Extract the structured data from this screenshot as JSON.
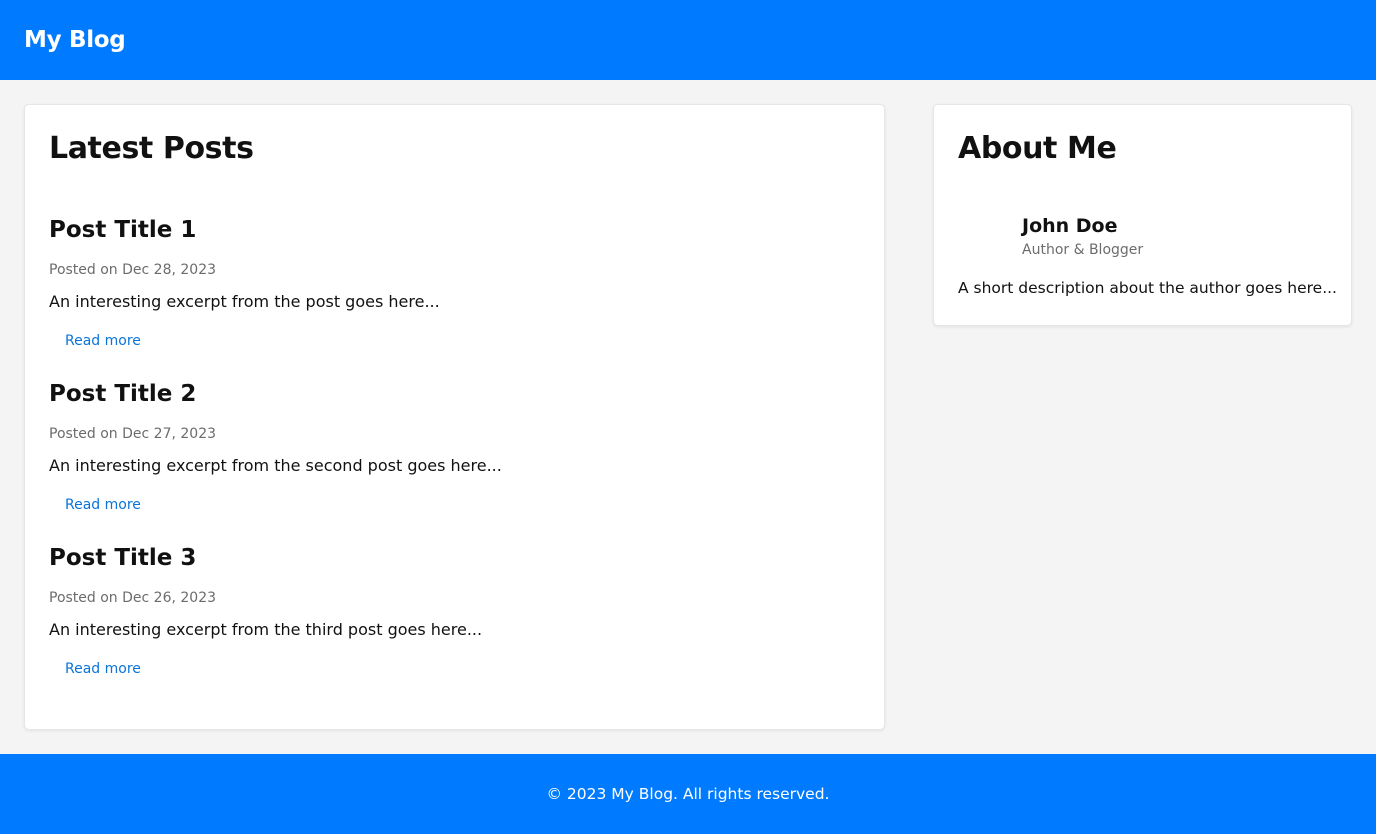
{
  "header": {
    "brand": "My Blog"
  },
  "posts_section": {
    "title": "Latest Posts",
    "posts": [
      {
        "title": "Post Title 1",
        "date": "Posted on Dec 28, 2023",
        "excerpt": "An interesting excerpt from the post goes here...",
        "link_label": "Read more"
      },
      {
        "title": "Post Title 2",
        "date": "Posted on Dec 27, 2023",
        "excerpt": "An interesting excerpt from the second post goes here...",
        "link_label": "Read more"
      },
      {
        "title": "Post Title 3",
        "date": "Posted on Dec 26, 2023",
        "excerpt": "An interesting excerpt from the third post goes here...",
        "link_label": "Read more"
      }
    ]
  },
  "about": {
    "title": "About Me",
    "name": "John Doe",
    "role": "Author & Blogger",
    "description": "A short description about the author goes here..."
  },
  "footer": {
    "text": "© 2023 My Blog. All rights reserved."
  },
  "colors": {
    "accent": "#007bff",
    "link": "#0a74d8",
    "background": "#f4f4f4",
    "muted_text": "#6c6c6c"
  }
}
